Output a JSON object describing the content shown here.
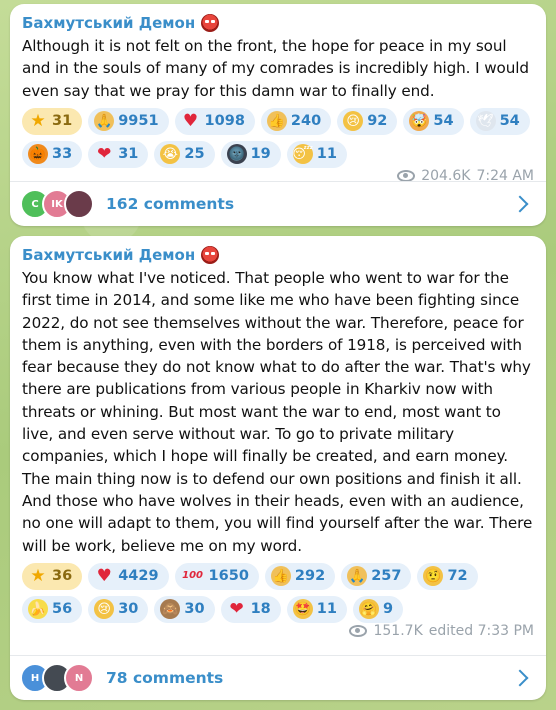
{
  "posts": [
    {
      "author": "Бахмутський Демон",
      "text": "Although it is not felt on the front, the hope for peace in my soul and in the souls of many of my comrades is incredibly high. I would even say that we pray for this damn war to finally end.",
      "reactions": [
        {
          "icon": "star-icon",
          "glyph": "★",
          "bg": "#f5b81c",
          "count": "31",
          "gold": true
        },
        {
          "icon": "folded-hands-icon",
          "glyph": "🙏",
          "bg": "#f0c05a",
          "count": "9951"
        },
        {
          "icon": "red-heart-icon",
          "glyph": "♥",
          "bg": "transparent",
          "count": "1098"
        },
        {
          "icon": "thumbs-up-icon",
          "glyph": "👍",
          "bg": "#f0c05a",
          "count": "240"
        },
        {
          "icon": "crying-face-icon",
          "glyph": "😢",
          "bg": "#f3c244",
          "count": "92"
        },
        {
          "icon": "exploding-head-icon",
          "glyph": "🤯",
          "bg": "#f1a94a",
          "count": "54"
        },
        {
          "icon": "dove-icon",
          "glyph": "🕊",
          "bg": "#dfe6ee",
          "count": "54"
        },
        {
          "icon": "jack-o-lantern-icon",
          "glyph": "🎃",
          "bg": "#f08a1c",
          "count": "33"
        },
        {
          "icon": "heart-on-fire-icon",
          "glyph": "❤",
          "bg": "transparent",
          "count": "31"
        },
        {
          "icon": "loudly-crying-face-icon",
          "glyph": "😭",
          "bg": "#f3c244",
          "count": "25"
        },
        {
          "icon": "new-moon-face-icon",
          "glyph": "🌚",
          "bg": "#3b4250",
          "count": "19"
        },
        {
          "icon": "sleeping-face-icon",
          "glyph": "😴",
          "bg": "#f3c244",
          "count": "11"
        }
      ],
      "views": "204.6K",
      "time": "7:24 AM",
      "comments_label": "162 comments",
      "commenters": [
        {
          "initials": "C",
          "color": "#4fbf5a"
        },
        {
          "initials": "IK",
          "color": "#e27b94"
        },
        {
          "initials": "",
          "color": "#6a3b4a"
        }
      ]
    },
    {
      "author": "Бахмутський Демон",
      "text": "You know what I've noticed. That people who went to war for the first time in 2014, and some like me who have been fighting since 2022, do not see themselves without the war. Therefore, peace for them is anything, even with the borders of 1918, is perceived with fear because they do not know what to do after the war. That's why there are publications from various people in Kharkiv now with threats or whining. But most want the war to end, most want to live, and even serve without war. To go to private military companies, which I hope will finally be created, and earn money. The main thing now is to defend our own positions and finish it all. And those who have wolves in their heads, even with an audience, no one will adapt to them, you will find yourself after the war. There will be work, believe me on my word.",
      "reactions": [
        {
          "icon": "star-icon",
          "glyph": "★",
          "bg": "#f5b81c",
          "count": "36",
          "gold": true
        },
        {
          "icon": "red-heart-icon",
          "glyph": "♥",
          "bg": "transparent",
          "count": "4429"
        },
        {
          "icon": "hundred-points-icon",
          "glyph": "100",
          "bg": "transparent",
          "count": "1650"
        },
        {
          "icon": "thumbs-up-icon",
          "glyph": "👍",
          "bg": "#f0c05a",
          "count": "292"
        },
        {
          "icon": "folded-hands-icon",
          "glyph": "🙏",
          "bg": "#f0c05a",
          "count": "257"
        },
        {
          "icon": "face-with-raised-eyebrow-icon",
          "glyph": "🤨",
          "bg": "#f3c244",
          "count": "72"
        },
        {
          "icon": "banana-icon",
          "glyph": "🍌",
          "bg": "#f7dc4a",
          "count": "56"
        },
        {
          "icon": "crying-face-icon",
          "glyph": "😢",
          "bg": "#f3c244",
          "count": "30"
        },
        {
          "icon": "see-no-evil-monkey-icon",
          "glyph": "🙈",
          "bg": "#a67a4f",
          "count": "30"
        },
        {
          "icon": "heart-on-fire-icon",
          "glyph": "❤",
          "bg": "transparent",
          "count": "18"
        },
        {
          "icon": "star-struck-icon",
          "glyph": "🤩",
          "bg": "#f3c244",
          "count": "11"
        },
        {
          "icon": "hugging-face-icon",
          "glyph": "🤗",
          "bg": "#f3c244",
          "count": "9"
        }
      ],
      "views": "151.7K",
      "time": "edited 7:33 PM",
      "comments_label": "78 comments",
      "commenters": [
        {
          "initials": "H",
          "color": "#4a90d9"
        },
        {
          "initials": "",
          "color": "#444a52"
        },
        {
          "initials": "N",
          "color": "#e27b94"
        }
      ]
    }
  ]
}
